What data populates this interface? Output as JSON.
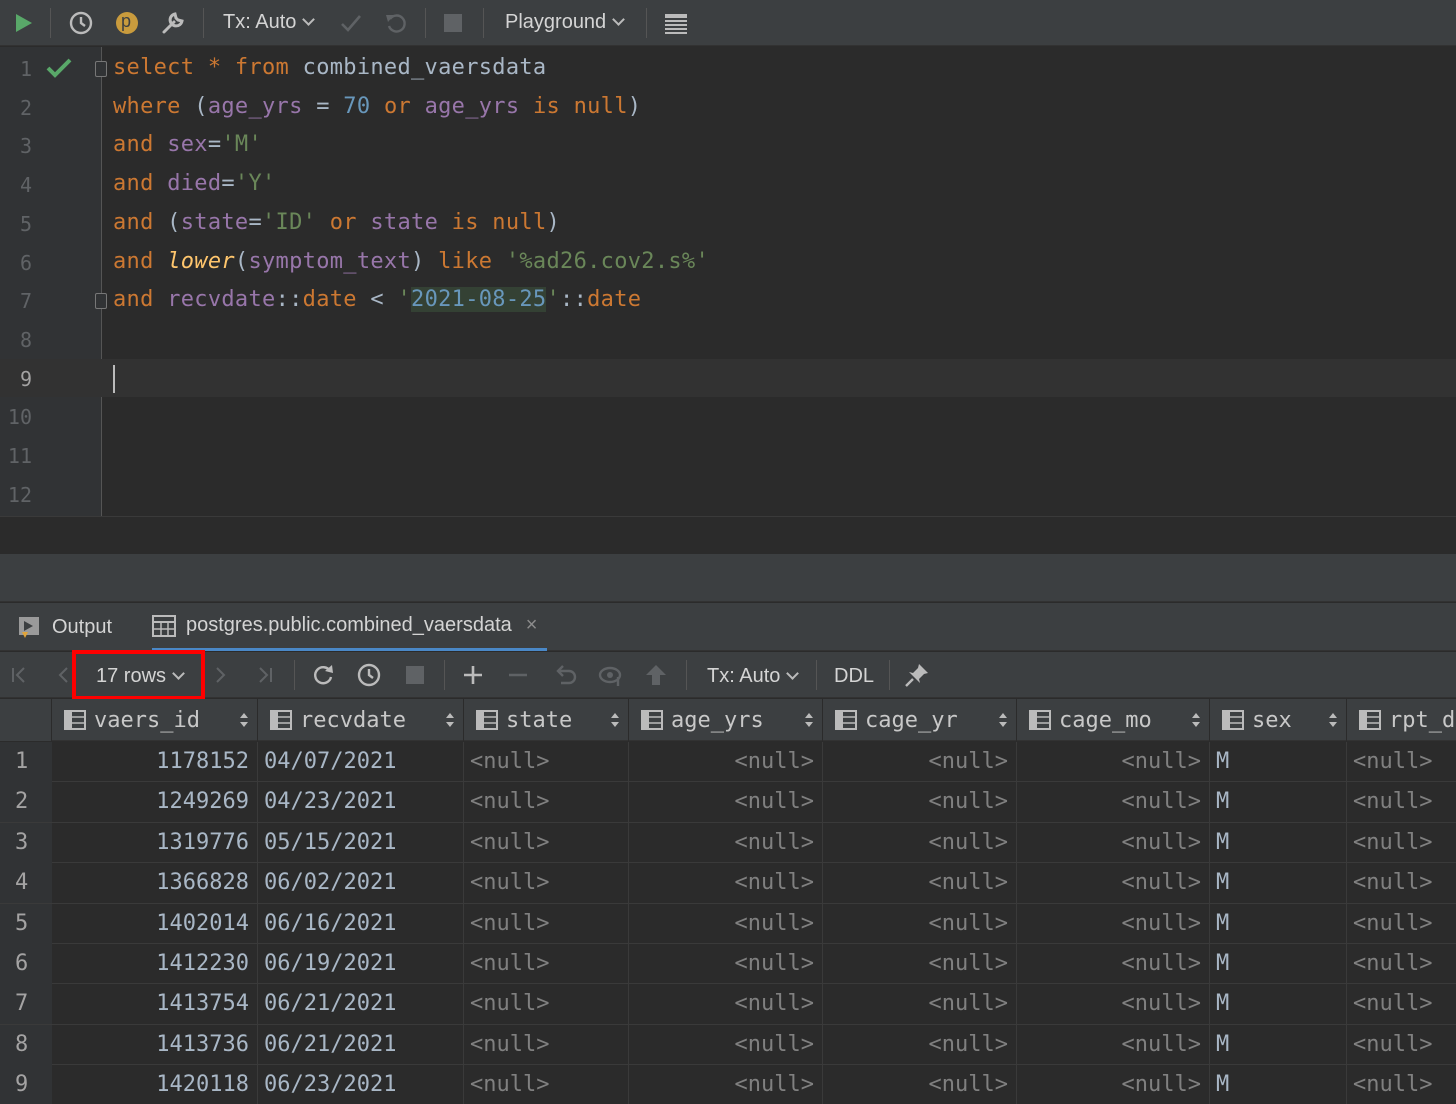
{
  "toolbar": {
    "tx_label": "Tx: Auto",
    "profile_badge": "p",
    "playground_label": "Playground"
  },
  "editor": {
    "line_numbers": [
      "1",
      "2",
      "3",
      "4",
      "5",
      "6",
      "7",
      "8",
      "9",
      "10",
      "11",
      "12"
    ],
    "lines": [
      [
        [
          "kw",
          "select"
        ],
        [
          "",
          ""
        ],
        [
          "kw",
          " * "
        ],
        [
          "kw",
          "from"
        ],
        [
          "",
          " combined_vaersdata"
        ]
      ],
      [
        [
          "kw",
          "where"
        ],
        [
          "",
          " ("
        ],
        [
          "col",
          "age_yrs"
        ],
        [
          "",
          " = "
        ],
        [
          "num",
          "70"
        ],
        [
          "",
          " "
        ],
        [
          "kw",
          "or"
        ],
        [
          "",
          " "
        ],
        [
          "col",
          "age_yrs"
        ],
        [
          "",
          " "
        ],
        [
          "kw",
          "is null"
        ],
        [
          "",
          ")"
        ]
      ],
      [
        [
          "kw",
          "and"
        ],
        [
          "",
          " "
        ],
        [
          "col",
          "sex"
        ],
        [
          "",
          "="
        ],
        [
          "str",
          "'M'"
        ]
      ],
      [
        [
          "kw",
          "and"
        ],
        [
          "",
          " "
        ],
        [
          "col",
          "died"
        ],
        [
          "",
          "="
        ],
        [
          "str",
          "'Y'"
        ]
      ],
      [
        [
          "kw",
          "and"
        ],
        [
          "",
          " ("
        ],
        [
          "col",
          "state"
        ],
        [
          "",
          "="
        ],
        [
          "str",
          "'ID'"
        ],
        [
          "",
          " "
        ],
        [
          "kw",
          "or"
        ],
        [
          "",
          " "
        ],
        [
          "col",
          "state"
        ],
        [
          "",
          " "
        ],
        [
          "kw",
          "is null"
        ],
        [
          "",
          ")"
        ]
      ],
      [
        [
          "kw",
          "and"
        ],
        [
          "",
          " "
        ],
        [
          "fn",
          "lower"
        ],
        [
          "",
          "("
        ],
        [
          "col",
          "symptom_text"
        ],
        [
          "",
          ") "
        ],
        [
          "kw",
          "like"
        ],
        [
          "",
          " "
        ],
        [
          "str",
          "'%ad26.cov2.s%'"
        ]
      ],
      [
        [
          "kw",
          "and"
        ],
        [
          "",
          " "
        ],
        [
          "col",
          "recvdate"
        ],
        [
          "",
          "::"
        ],
        [
          "kw",
          "date"
        ],
        [
          "",
          " < "
        ],
        [
          "str",
          "'"
        ],
        [
          "hl",
          "2021-08-25"
        ],
        [
          "str",
          "'"
        ],
        [
          "",
          "::"
        ],
        [
          "kw",
          "date"
        ]
      ]
    ]
  },
  "tabs": {
    "output_label": "Output",
    "table_label": "postgres.public.combined_vaersdata",
    "close_glyph": "×"
  },
  "results_toolbar": {
    "rows_label": "17 rows",
    "tx_label": "Tx: Auto",
    "ddl_label": "DDL"
  },
  "grid": {
    "columns": [
      "vaers_id",
      "recvdate",
      "state",
      "age_yrs",
      "cage_yr",
      "cage_mo",
      "sex",
      "rpt_d"
    ],
    "rows": [
      {
        "num": "1",
        "vaers_id": "1178152",
        "recvdate": "04/07/2021",
        "state": "<null>",
        "age_yrs": "<null>",
        "cage_yr": "<null>",
        "cage_mo": "<null>",
        "sex": "M",
        "rpt": "<null>"
      },
      {
        "num": "2",
        "vaers_id": "1249269",
        "recvdate": "04/23/2021",
        "state": "<null>",
        "age_yrs": "<null>",
        "cage_yr": "<null>",
        "cage_mo": "<null>",
        "sex": "M",
        "rpt": "<null>"
      },
      {
        "num": "3",
        "vaers_id": "1319776",
        "recvdate": "05/15/2021",
        "state": "<null>",
        "age_yrs": "<null>",
        "cage_yr": "<null>",
        "cage_mo": "<null>",
        "sex": "M",
        "rpt": "<null>"
      },
      {
        "num": "4",
        "vaers_id": "1366828",
        "recvdate": "06/02/2021",
        "state": "<null>",
        "age_yrs": "<null>",
        "cage_yr": "<null>",
        "cage_mo": "<null>",
        "sex": "M",
        "rpt": "<null>"
      },
      {
        "num": "5",
        "vaers_id": "1402014",
        "recvdate": "06/16/2021",
        "state": "<null>",
        "age_yrs": "<null>",
        "cage_yr": "<null>",
        "cage_mo": "<null>",
        "sex": "M",
        "rpt": "<null>"
      },
      {
        "num": "6",
        "vaers_id": "1412230",
        "recvdate": "06/19/2021",
        "state": "<null>",
        "age_yrs": "<null>",
        "cage_yr": "<null>",
        "cage_mo": "<null>",
        "sex": "M",
        "rpt": "<null>"
      },
      {
        "num": "7",
        "vaers_id": "1413754",
        "recvdate": "06/21/2021",
        "state": "<null>",
        "age_yrs": "<null>",
        "cage_yr": "<null>",
        "cage_mo": "<null>",
        "sex": "M",
        "rpt": "<null>"
      },
      {
        "num": "8",
        "vaers_id": "1413736",
        "recvdate": "06/21/2021",
        "state": "<null>",
        "age_yrs": "<null>",
        "cage_yr": "<null>",
        "cage_mo": "<null>",
        "sex": "M",
        "rpt": "<null>"
      },
      {
        "num": "9",
        "vaers_id": "1420118",
        "recvdate": "06/23/2021",
        "state": "<null>",
        "age_yrs": "<null>",
        "cage_yr": "<null>",
        "cage_mo": "<null>",
        "sex": "M",
        "rpt": "<null>"
      }
    ]
  },
  "icons": {
    "run": "play-icon",
    "history": "clock-icon",
    "settings": "wrench-icon",
    "commit": "check-icon",
    "rollback": "undo-icon",
    "stop": "stop-icon",
    "layout": "table-view-icon"
  },
  "colors": {
    "keyword": "#cc7832",
    "column": "#9876aa",
    "number": "#6897bb",
    "string": "#6a8759",
    "function": "#ffc66d",
    "highlight_box": "#ff0000",
    "run_green": "#59a869"
  }
}
